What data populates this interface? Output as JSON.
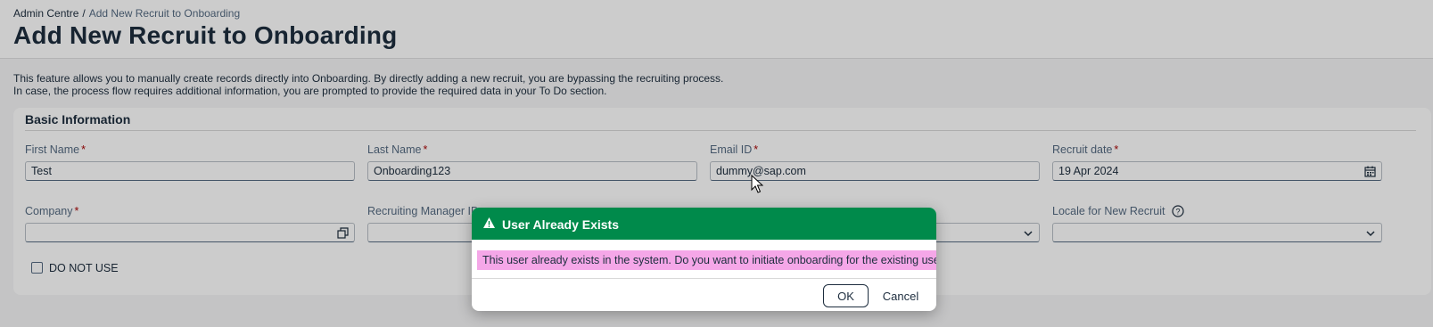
{
  "breadcrumb": {
    "root": "Admin Centre",
    "separator": "/",
    "current": "Add New Recruit to Onboarding"
  },
  "page": {
    "title": "Add New Recruit to Onboarding",
    "description_line1": "This feature allows you to manually create records directly into Onboarding. By directly adding a new recruit, you are bypassing the recruiting process.",
    "description_line2": "In case, the process flow requires additional information, you are prompted to provide the required data in your To Do section."
  },
  "section": {
    "title": "Basic Information",
    "fields": {
      "first_name": {
        "label": "First Name",
        "value": "Test",
        "required": "*"
      },
      "last_name": {
        "label": "Last Name",
        "value": "Onboarding123",
        "required": "*"
      },
      "email": {
        "label": "Email ID",
        "value": "dummy@sap.com",
        "required": "*"
      },
      "recruit_date": {
        "label": "Recruit date",
        "value": "19 Apr 2024",
        "required": "*"
      },
      "company": {
        "label": "Company",
        "value": "",
        "required": "*"
      },
      "recruiting_manager": {
        "label": "Recruiting Manager ID",
        "value": ""
      },
      "locale": {
        "label": "Locale for New Recruit",
        "value": ""
      }
    },
    "checkbox": {
      "label": "DO NOT USE"
    }
  },
  "dialog": {
    "title": "User Already Exists",
    "message": "This user already exists in the system. Do you want to initiate onboarding for the existing user?",
    "ok_label": "OK",
    "cancel_label": "Cancel"
  },
  "colors": {
    "dialog_header": "#008a4b",
    "message_highlight": "#f5a7e8",
    "required_marker": "#aa0808"
  }
}
